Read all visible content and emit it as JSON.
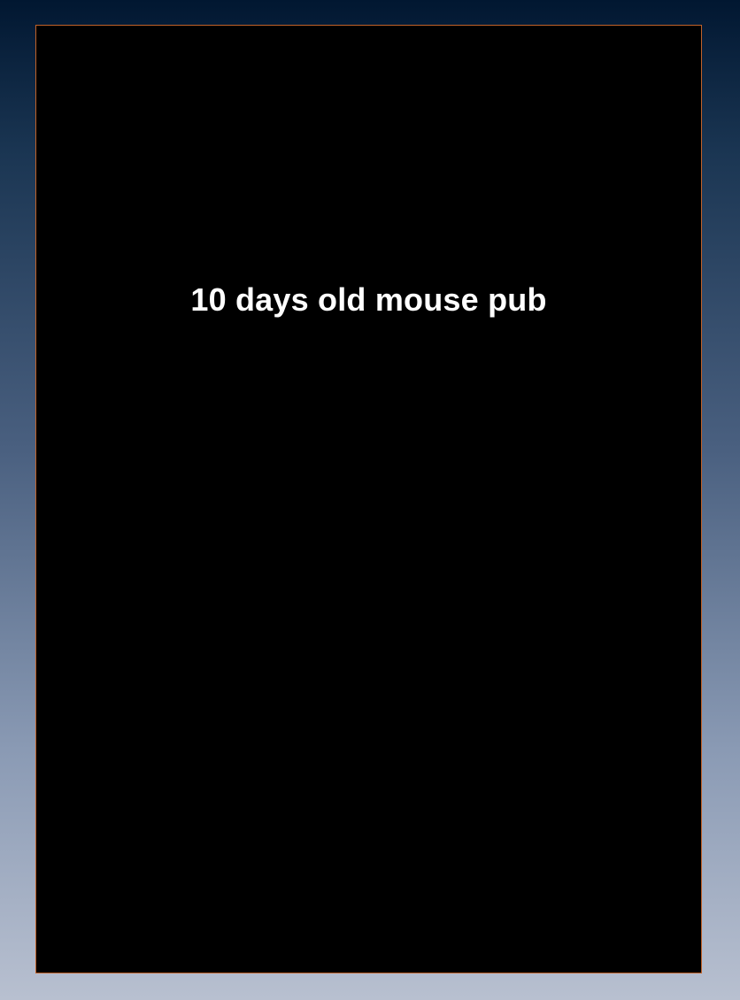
{
  "slide": {
    "caption": "10 days old mouse pub"
  },
  "colors": {
    "background_top": "#011731",
    "background_bottom": "#b8c0d0",
    "panel": "#000000",
    "panel_border": "#c0622a",
    "caption_text": "#ffffff"
  }
}
